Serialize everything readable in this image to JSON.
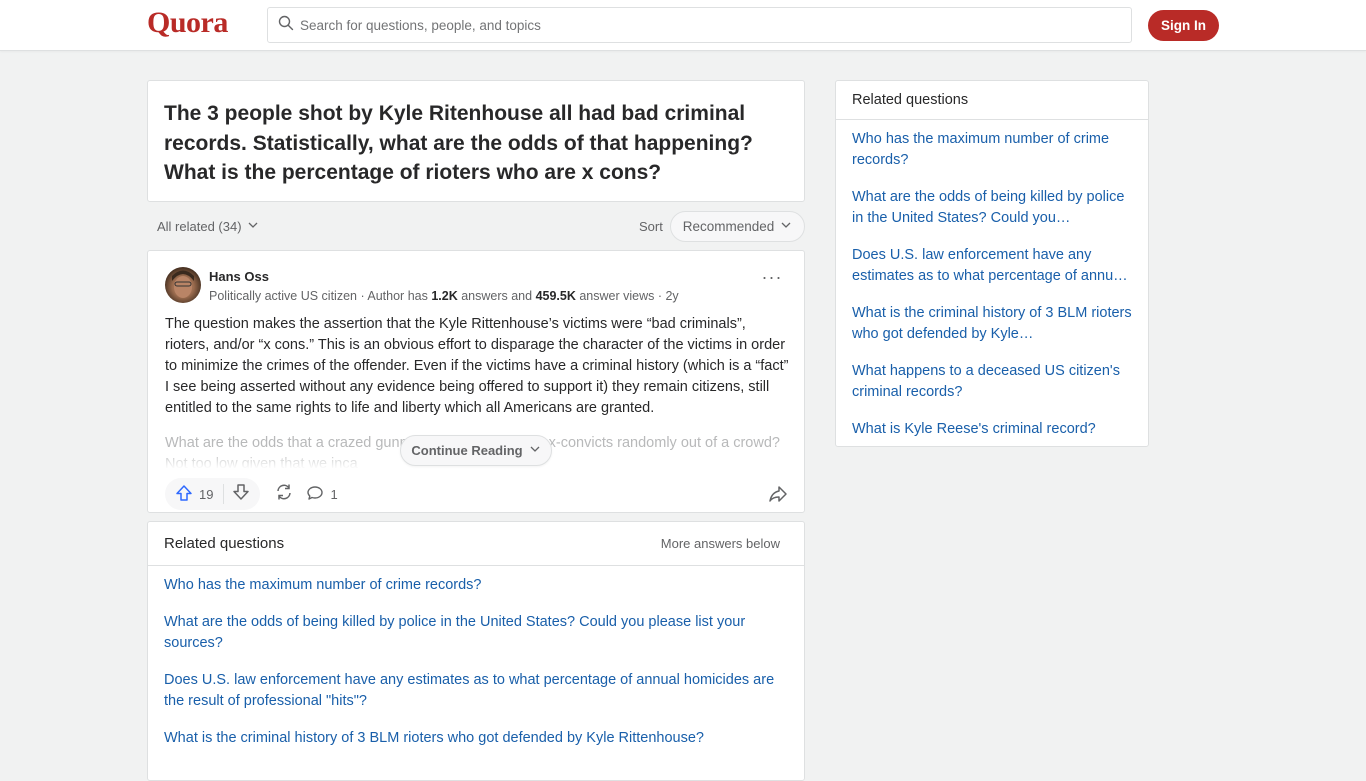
{
  "header": {
    "logo": "Quora",
    "search_placeholder": "Search for questions, people, and topics",
    "signin_label": "Sign In"
  },
  "question": {
    "title": "The 3 people shot by Kyle Ritenhouse all had bad criminal records. Statistically, what are the odds of that happening? What is the percentage of rioters who are x cons?"
  },
  "filter": {
    "all_related_label": "All related (34)",
    "sort_label": "Sort",
    "sort_value": "Recommended"
  },
  "answer": {
    "author_name": "Hans Oss",
    "cred_prefix": "Politically active US citizen · Author has ",
    "answers_count": "1.2K",
    "cred_mid": " answers and ",
    "views_count": "459.5K",
    "cred_suffix": " answer views · 2y",
    "more_icon": "···",
    "body": "The question makes the assertion that the Kyle Rittenhouse’s victims were “bad criminals”, rioters, and/or “x cons.” This is an obvious effort to disparage the character of the victims in order to minimize the crimes of the offender. Even if the victims have a criminal history (which is a “fact” I see being asserted without any evidence being offered to support it) they remain citizens, still entitled to the same rights to life and liberty which all Americans are granted.",
    "faded": "What are the odds that a crazed gunman would pick three ex-convicts randomly out of a crowd? Not too low given that we inca",
    "continue_label": "Continue Reading",
    "upvotes": "19",
    "comments": "1"
  },
  "related_main": {
    "title": "Related questions",
    "more_label": "More answers below",
    "items": [
      "Who has the maximum number of crime records?",
      "What are the odds of being killed by police in the United States? Could you please list your sources?",
      "Does U.S. law enforcement have any estimates as to what percentage of annual homicides are the result of professional \"hits\"?",
      "What is the criminal history of 3 BLM rioters who got defended by Kyle Rittenhouse?"
    ]
  },
  "related_side": {
    "title": "Related questions",
    "items": [
      "Who has the maximum number of crime records?",
      "What are the odds of being killed by police in the United States? Could you…",
      "Does U.S. law enforcement have any estimates as to what percentage of annu…",
      "What is the criminal history of 3 BLM rioters who got defended by Kyle…",
      "What happens to a deceased US citizen's criminal records?",
      "What is Kyle Reese's criminal record?"
    ]
  },
  "colors": {
    "brand": "#b92b27",
    "link": "#195faa",
    "upvote": "#2e69ff"
  }
}
